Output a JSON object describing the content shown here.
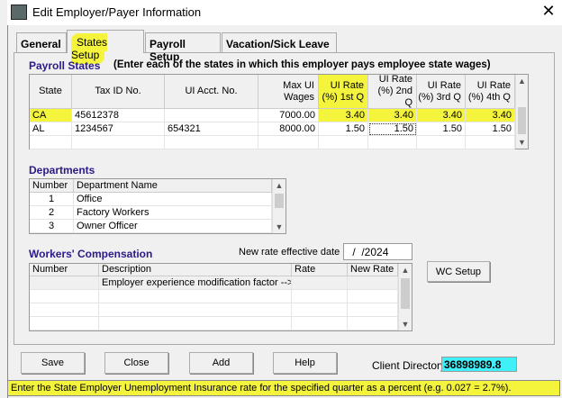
{
  "window": {
    "title": "Edit Employer/Payer Information"
  },
  "tabs": [
    {
      "label": "General",
      "active": false
    },
    {
      "label": "States Setup",
      "active": true
    },
    {
      "label": "Payroll Setup",
      "active": false
    },
    {
      "label": "Vacation/Sick Leave",
      "active": false
    }
  ],
  "payroll_states": {
    "title": "Payroll States",
    "instruction": "(Enter each of the states in which this employer pays employee state wages)",
    "columns": [
      "State",
      "Tax ID No.",
      "UI Acct. No.",
      "Max UI Wages",
      "UI Rate (%) 1st Q",
      "UI Rate (%) 2nd Q",
      "UI Rate (%) 3rd Q",
      "UI Rate (%) 4th Q"
    ],
    "rows": [
      [
        "CA",
        "45612378",
        "",
        "7000.00",
        "3.40",
        "3.40",
        "3.40",
        "3.40"
      ],
      [
        "AL",
        "1234567",
        "654321",
        "8000.00",
        "1.50",
        "1.50",
        "1.50",
        "1.50"
      ]
    ]
  },
  "departments": {
    "title": "Departments",
    "columns": [
      "Number",
      "Department Name"
    ],
    "rows": [
      [
        "1",
        "Office"
      ],
      [
        "2",
        "Factory Workers"
      ],
      [
        "3",
        "Owner Officer"
      ]
    ]
  },
  "workers_comp": {
    "title": "Workers' Compensation",
    "date_label": "New rate effective date",
    "date_value": " /  /2024",
    "columns": [
      "Number",
      "Description",
      "Rate",
      "New Rate"
    ],
    "rows": [
      [
        "",
        "Employer experience modification factor -->",
        "",
        ""
      ]
    ],
    "setup_button": "WC Setup"
  },
  "buttons": {
    "save": "Save",
    "close": "Close",
    "add": "Add",
    "help": "Help"
  },
  "client_directory": {
    "label": "Client Directory",
    "value": "36898989.8"
  },
  "status_bar": "Enter the State Employer Unemployment Insurance rate for the specified quarter as a percent (e.g. 0.027 = 2.7%).",
  "colors": {
    "highlight": "#f4f43c",
    "section_title": "#2a1a8a",
    "client_dir_bg": "#40f0f8"
  }
}
